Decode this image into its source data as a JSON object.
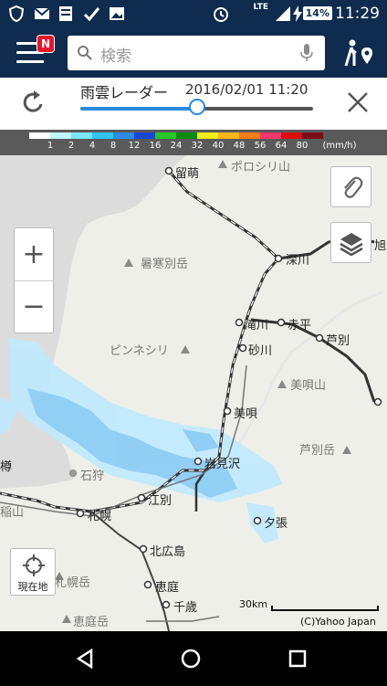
{
  "status_bar": {
    "time": "11:29",
    "battery": "14%",
    "network": "LTE"
  },
  "top_bar": {
    "menu_badge": "N",
    "search_placeholder": "検索"
  },
  "radar": {
    "title": "雨雲レーダー",
    "datetime": "2016/02/01 11:20",
    "slider_fraction": 0.5
  },
  "legend": {
    "values": [
      "1",
      "2",
      "4",
      "8",
      "12",
      "16",
      "24",
      "32",
      "40",
      "48",
      "56",
      "64",
      "80"
    ],
    "unit": "(mm/h)",
    "colors": [
      "#ffffff",
      "#bff6ff",
      "#79e8f8",
      "#2fc5f0",
      "#2d8be8",
      "#1547d0",
      "#26c72a",
      "#0d8a0b",
      "#f1ec1a",
      "#f7b71a",
      "#f57c17",
      "#f0376a",
      "#d90d0d",
      "#7a0c1a"
    ]
  },
  "map": {
    "places": [
      {
        "name": "留萌",
        "gray": false
      },
      {
        "name": "ポロシリ山",
        "gray": true
      },
      {
        "name": "旭",
        "gray": false
      },
      {
        "name": "暑寒別岳",
        "gray": true
      },
      {
        "name": "深川",
        "gray": false
      },
      {
        "name": "滝川",
        "gray": false
      },
      {
        "name": "赤平",
        "gray": false
      },
      {
        "name": "芦別",
        "gray": false
      },
      {
        "name": "ピンネシリ",
        "gray": true
      },
      {
        "name": "砂川",
        "gray": false
      },
      {
        "name": "美唄山",
        "gray": true
      },
      {
        "name": "美唄",
        "gray": false
      },
      {
        "name": "芦別岳",
        "gray": true
      },
      {
        "name": "樽",
        "gray": false
      },
      {
        "name": "岩見沢",
        "gray": false
      },
      {
        "name": "石狩",
        "gray": true
      },
      {
        "name": "稲山",
        "gray": true
      },
      {
        "name": "江別",
        "gray": false
      },
      {
        "name": "札幌",
        "gray": false
      },
      {
        "name": "夕張",
        "gray": false
      },
      {
        "name": "北広島",
        "gray": false
      },
      {
        "name": "恵庭",
        "gray": false
      },
      {
        "name": "千歳",
        "gray": false
      },
      {
        "name": "札幌岳",
        "gray": true
      },
      {
        "name": "恵庭岳",
        "gray": true
      }
    ],
    "locate_label": "現在地",
    "scale_label": "30km",
    "copyright": "(C)Yahoo Japan"
  }
}
